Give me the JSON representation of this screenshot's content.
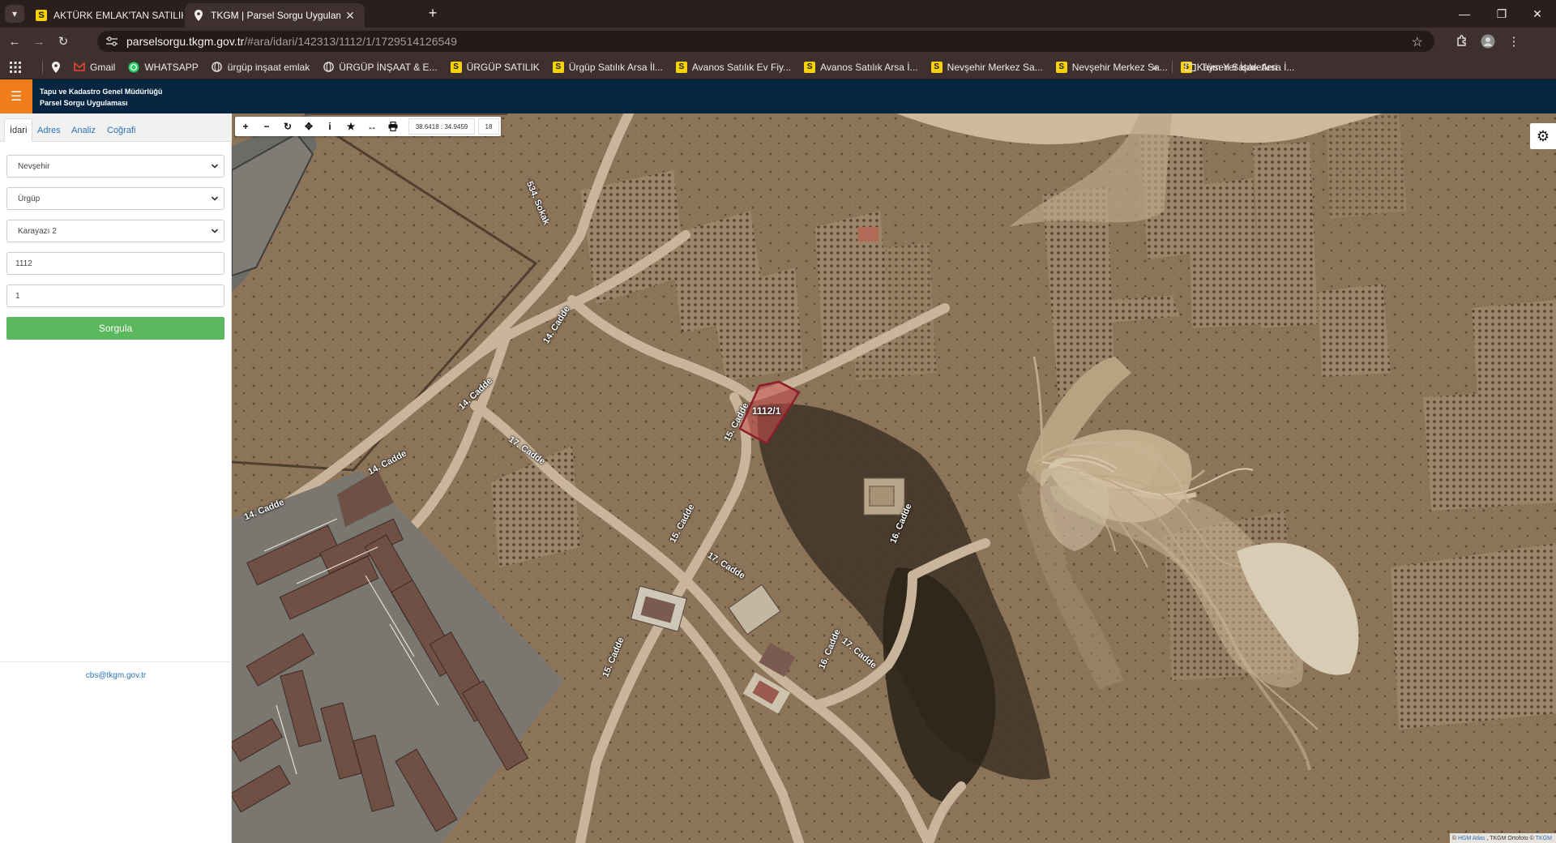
{
  "browser": {
    "tabs": [
      {
        "title": "AKTÜRK EMLAK'TAN SATILIK BE",
        "favicon": "s-icon",
        "active": false
      },
      {
        "title": "TKGM | Parsel Sorgu Uygulama",
        "favicon": "location-pin-icon",
        "active": true
      }
    ],
    "url_domain": "parselsorgu.tkgm.gov.tr",
    "url_path": "/#ara/idari/142313/1112/1/1729514126549",
    "bookmarks": [
      {
        "label": "Gmail",
        "icon": "gmail-icon"
      },
      {
        "label": "WHATSAPP",
        "icon": "whatsapp-icon"
      },
      {
        "label": "ürgüp inşaat emlak",
        "icon": "globe-icon"
      },
      {
        "label": "ÜRGÜP İNŞAAT & E...",
        "icon": "globe-icon"
      },
      {
        "label": "ÜRGÜP SATILIK",
        "icon": "s-icon"
      },
      {
        "label": "Ürgüp Satılık Arsa İl...",
        "icon": "s-icon"
      },
      {
        "label": "Avanos Satılık Ev Fiy...",
        "icon": "s-icon"
      },
      {
        "label": "Avanos Satılık Arsa İ...",
        "icon": "s-icon"
      },
      {
        "label": "Nevşehir Merkez Sa...",
        "icon": "s-icon"
      },
      {
        "label": "Nevşehir Merkez Sa...",
        "icon": "s-icon"
      },
      {
        "label": "Kayseri Satılık Arsa İ...",
        "icon": "s-icon"
      }
    ],
    "all_bookmarks_label": "Tüm Yer İşaretleri"
  },
  "app": {
    "title_line1": "Tapu ve Kadastro Genel Müdürlüğü",
    "title_line2": "Parsel Sorgu Uygulaması",
    "accent_color": "#f07d1c",
    "header_color": "#052540"
  },
  "sidebar": {
    "tabs": [
      {
        "label": "İdari",
        "active": true
      },
      {
        "label": "Adres",
        "active": false
      },
      {
        "label": "Analiz",
        "active": false
      },
      {
        "label": "Coğrafi",
        "active": false
      }
    ],
    "il": "Nevşehir",
    "ilce": "Ürgüp",
    "mahalle": "Karayazı 2",
    "ada": "1112",
    "parsel": "1",
    "query_button": "Sorgula",
    "query_color": "#5cb85c",
    "footer_email": "cbs@tkgm.gov.tr"
  },
  "map": {
    "coordinates": "38.6418 : 34.9459",
    "zoom": "18",
    "parcel_label": "1112/1",
    "road_labels": [
      "534. Sokak",
      "14. Cadde",
      "14. Cadde",
      "14. Cadde",
      "14. Cadde",
      "15. Cadde",
      "15. Cadde",
      "15. Cadde",
      "17. Cadde",
      "17. Cadde",
      "17. Cadde",
      "16. Cadde",
      "16. Cadde"
    ],
    "attribution": {
      "prefix": "©",
      "link1": "HGM Atlas",
      "middle": ", TKGM Ortofoto ©",
      "link2": "TKGM"
    }
  }
}
